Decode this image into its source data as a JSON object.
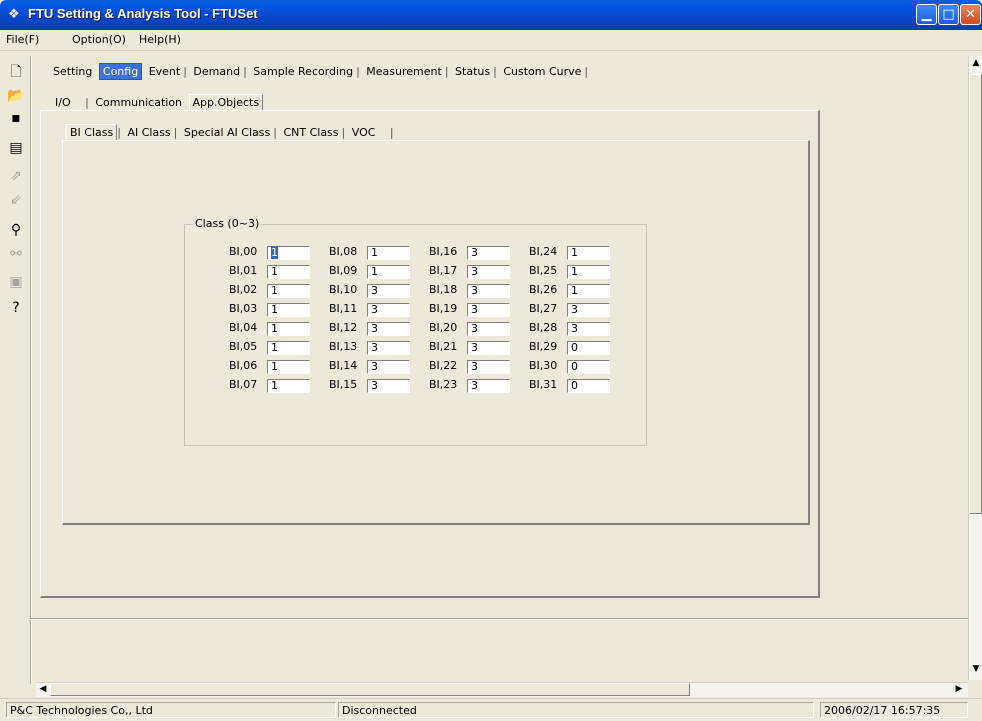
{
  "window": {
    "title": "FTU Setting & Analysis Tool - FTUSet",
    "app_icon": "satellite-dish-icon"
  },
  "menu": {
    "items": [
      "File(F)",
      "Option(O)",
      "Help(H)"
    ]
  },
  "toolbar": {
    "buttons": [
      {
        "icon": "new-document-icon",
        "enabled": true
      },
      {
        "icon": "open-folder-icon",
        "enabled": true
      },
      {
        "icon": "save-disk-icon",
        "enabled": true
      },
      {
        "icon": "list-view-icon",
        "enabled": true
      },
      {
        "icon": "upload-arrow-icon",
        "enabled": false
      },
      {
        "icon": "download-arrow-icon",
        "enabled": false
      },
      {
        "icon": "connect-icon",
        "enabled": true
      },
      {
        "icon": "disconnect-icon",
        "enabled": false
      },
      {
        "icon": "monitor-icon",
        "enabled": false
      },
      {
        "icon": "help-icon",
        "enabled": true
      }
    ]
  },
  "tabs_main": {
    "items": [
      "Setting",
      "Config",
      "Event",
      "Demand",
      "Sample Recording",
      "Measurement",
      "Status",
      "Custom Curve"
    ],
    "selected": "Config"
  },
  "tabs_config": {
    "items": [
      "I/O",
      "Communication",
      "App.Objects"
    ],
    "selected": "App.Objects"
  },
  "tabs_app": {
    "items": [
      "BI Class",
      "AI Class",
      "Special AI  Class",
      "CNT Class",
      "VOC"
    ],
    "selected": "BI Class"
  },
  "group": {
    "legend": "Class (0~3)",
    "columns": [
      [
        {
          "label": "BI,00",
          "value": "1"
        },
        {
          "label": "BI,01",
          "value": "1"
        },
        {
          "label": "BI,02",
          "value": "1"
        },
        {
          "label": "BI,03",
          "value": "1"
        },
        {
          "label": "BI,04",
          "value": "1"
        },
        {
          "label": "BI,05",
          "value": "1"
        },
        {
          "label": "BI,06",
          "value": "1"
        },
        {
          "label": "BI,07",
          "value": "1"
        }
      ],
      [
        {
          "label": "BI,08",
          "value": "1"
        },
        {
          "label": "BI,09",
          "value": "1"
        },
        {
          "label": "BI,10",
          "value": "3"
        },
        {
          "label": "BI,11",
          "value": "3"
        },
        {
          "label": "BI,12",
          "value": "3"
        },
        {
          "label": "BI,13",
          "value": "3"
        },
        {
          "label": "BI,14",
          "value": "3"
        },
        {
          "label": "BI,15",
          "value": "3"
        }
      ],
      [
        {
          "label": "BI,16",
          "value": "3"
        },
        {
          "label": "BI,17",
          "value": "3"
        },
        {
          "label": "BI,18",
          "value": "3"
        },
        {
          "label": "BI,19",
          "value": "3"
        },
        {
          "label": "BI,20",
          "value": "3"
        },
        {
          "label": "BI,21",
          "value": "3"
        },
        {
          "label": "BI,22",
          "value": "3"
        },
        {
          "label": "BI,23",
          "value": "3"
        }
      ],
      [
        {
          "label": "BI,24",
          "value": "1"
        },
        {
          "label": "BI,25",
          "value": "1"
        },
        {
          "label": "BI,26",
          "value": "1"
        },
        {
          "label": "BI,27",
          "value": "3"
        },
        {
          "label": "BI,28",
          "value": "3"
        },
        {
          "label": "BI,29",
          "value": "0"
        },
        {
          "label": "BI,30",
          "value": "0"
        },
        {
          "label": "BI,31",
          "value": "0"
        }
      ]
    ]
  },
  "statusbar": {
    "company": "P&C Technologies Co,, Ltd",
    "connection": "Disconnected",
    "datetime": "2006/02/17 16:57:35"
  }
}
